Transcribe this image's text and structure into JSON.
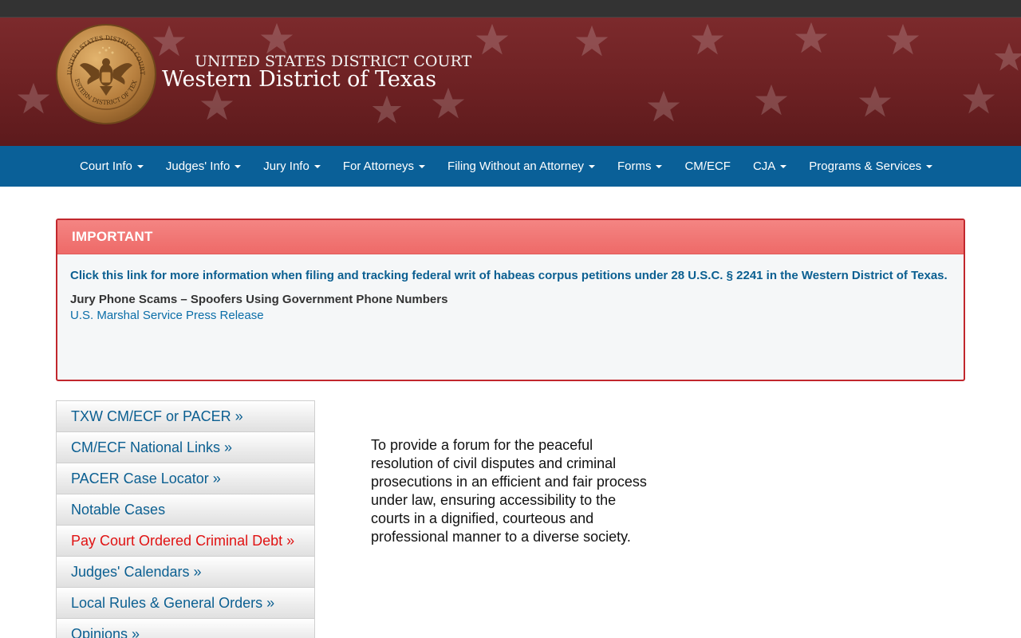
{
  "header": {
    "line1": "UNITED STATES DISTRICT COURT",
    "line2": "Western District of Texas",
    "seal_top_text": "UNITED STATES DISTRICT COURT",
    "seal_bottom_text": "WESTERN DISTRICT OF TEXAS"
  },
  "nav": {
    "items": [
      {
        "label": "Court Info",
        "dropdown": true
      },
      {
        "label": "Judges' Info",
        "dropdown": true
      },
      {
        "label": "Jury Info",
        "dropdown": true
      },
      {
        "label": "For Attorneys",
        "dropdown": true
      },
      {
        "label": "Filing Without an Attorney",
        "dropdown": true
      },
      {
        "label": "Forms",
        "dropdown": true
      },
      {
        "label": "CM/ECF",
        "dropdown": false
      },
      {
        "label": "CJA",
        "dropdown": true
      },
      {
        "label": "Programs & Services",
        "dropdown": true
      }
    ]
  },
  "alert": {
    "title": "IMPORTANT",
    "link_text": "Click this link for more information when filing and tracking federal writ of habeas corpus petitions under 28 U.S.C. § 2241 in the Western District of Texas.",
    "subheading": "Jury Phone Scams – Spoofers Using Government Phone Numbers",
    "press_link": "U.S. Marshal Service Press Release"
  },
  "sidebar": {
    "items": [
      {
        "label": "TXW CM/ECF or PACER »"
      },
      {
        "label": "CM/ECF National Links »"
      },
      {
        "label": "PACER Case Locator »"
      },
      {
        "label": "Notable Cases"
      },
      {
        "label": "Pay Court Ordered Criminal Debt »"
      },
      {
        "label": "Judges' Calendars »"
      },
      {
        "label": "Local Rules & General Orders »"
      },
      {
        "label": "Opinions »"
      }
    ]
  },
  "mission": {
    "text": "To provide a forum for the peaceful resolution of civil disputes and criminal prosecutions in an efficient and fair process under law, ensuring accessibility to the courts in a dignified, courteous and professional manner to a diverse society."
  },
  "colors": {
    "banner": "#6b2022",
    "nav": "#0a6098",
    "alert_border": "#c1272d",
    "alert_header": "#ee6a68",
    "link": "#0b5f91",
    "debt_link": "#e01212"
  }
}
